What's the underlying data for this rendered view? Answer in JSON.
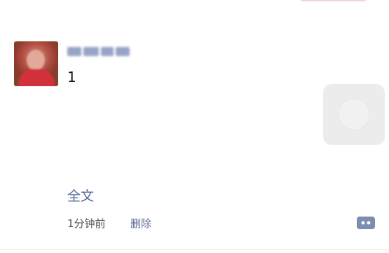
{
  "post": {
    "text": "1",
    "image_icon": "image-placeholder-icon"
  },
  "actions": {
    "full_text_label": "全文",
    "time_label": "1分钟前",
    "delete_label": "删除",
    "more_icon": "comment-more-icon"
  },
  "colors": {
    "link": "#576b95",
    "text": "#111111",
    "meta": "#555555",
    "image_placeholder": "#ececec"
  }
}
